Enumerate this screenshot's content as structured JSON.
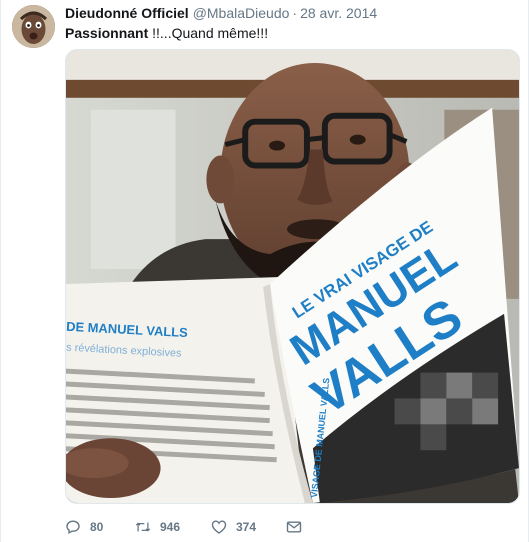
{
  "tweet": {
    "author_name": "Dieudonné Officiel",
    "author_handle": "@MbalaDieudo",
    "separator": "·",
    "date": "28 avr. 2014",
    "text_bold": "Passionnant",
    "text_rest": " !!...Quand même!!!"
  },
  "media": {
    "book_cover_line1": "LE VRAI VISAGE DE",
    "book_cover_line2": "MANUEL",
    "book_cover_line3": "VALLS",
    "left_page_title": "DE MANUEL VALLS",
    "left_page_subtitle": "s révélations explosives",
    "spine_text": "VISAGE DE MANUEL VALLS"
  },
  "actions": {
    "reply_count": "80",
    "retweet_count": "946",
    "like_count": "374"
  },
  "colors": {
    "accent_blue": "#1da1f2",
    "secondary_text": "#657786",
    "book_blue": "#1f7fc6"
  },
  "icons": [
    "reply-icon",
    "retweet-icon",
    "like-icon",
    "direct-message-icon"
  ]
}
